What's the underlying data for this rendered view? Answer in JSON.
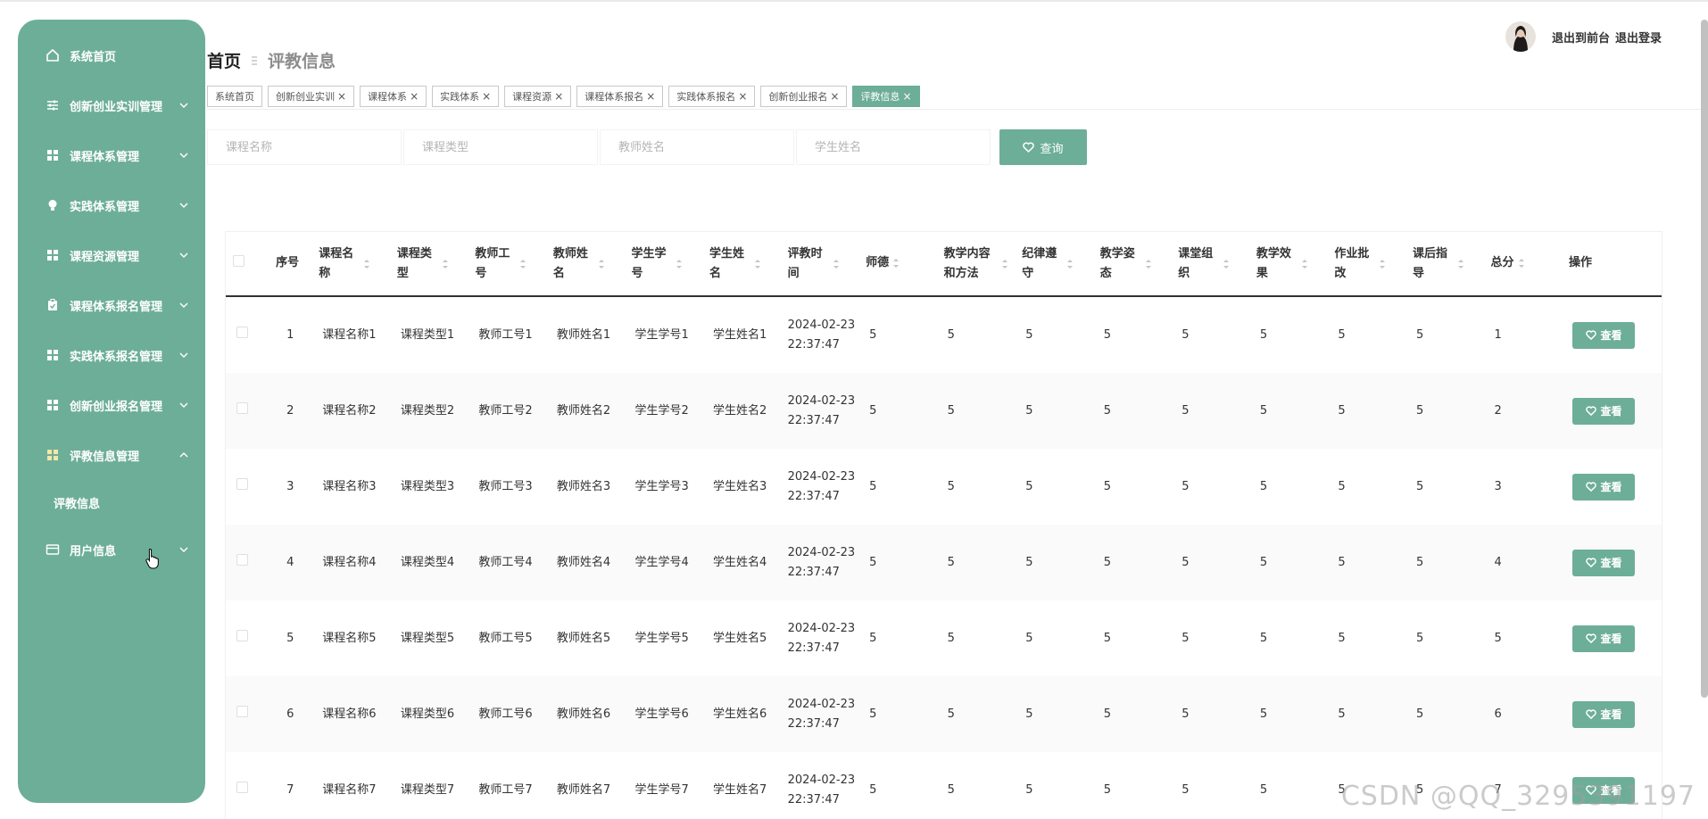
{
  "sidebar": {
    "items": [
      {
        "label": "系统首页",
        "icon": "home-icon",
        "chevron": false
      },
      {
        "label": "创新创业实训管理",
        "icon": "sliders-icon",
        "chevron": true
      },
      {
        "label": "课程体系管理",
        "icon": "grid-icon",
        "chevron": true
      },
      {
        "label": "实践体系管理",
        "icon": "bulb-icon",
        "chevron": true
      },
      {
        "label": "课程资源管理",
        "icon": "grid-icon",
        "chevron": true
      },
      {
        "label": "课程体系报名管理",
        "icon": "clipboard-icon",
        "chevron": true
      },
      {
        "label": "实践体系报名管理",
        "icon": "grid-icon",
        "chevron": true
      },
      {
        "label": "创新创业报名管理",
        "icon": "grid-icon",
        "chevron": true
      },
      {
        "label": "评教信息管理",
        "icon": "grid-icon",
        "chevron": true,
        "expanded": true
      },
      {
        "label": "用户信息",
        "icon": "card-icon",
        "chevron": true
      }
    ],
    "submenu": {
      "label": "评教信息"
    }
  },
  "breadcrumb": {
    "home": "首页",
    "current": "评教信息"
  },
  "header": {
    "to_front": "退出到前台",
    "logout": "退出登录"
  },
  "tags": [
    {
      "label": "系统首页",
      "closable": false,
      "active": false
    },
    {
      "label": "创新创业实训",
      "closable": true,
      "active": false
    },
    {
      "label": "课程体系",
      "closable": true,
      "active": false
    },
    {
      "label": "实践体系",
      "closable": true,
      "active": false
    },
    {
      "label": "课程资源",
      "closable": true,
      "active": false
    },
    {
      "label": "课程体系报名",
      "closable": true,
      "active": false
    },
    {
      "label": "实践体系报名",
      "closable": true,
      "active": false
    },
    {
      "label": "创新创业报名",
      "closable": true,
      "active": false
    },
    {
      "label": "评教信息",
      "closable": true,
      "active": true
    }
  ],
  "filters": {
    "course_name": {
      "placeholder": "课程名称"
    },
    "course_type": {
      "placeholder": "课程类型"
    },
    "teacher_name": {
      "placeholder": "教师姓名"
    },
    "student_name": {
      "placeholder": "学生姓名"
    },
    "query_label": "查询"
  },
  "table": {
    "columns": [
      {
        "key": "no",
        "label": "序号",
        "sortable": false
      },
      {
        "key": "course_name",
        "label": "课程名称",
        "sortable": true
      },
      {
        "key": "course_type",
        "label": "课程类型",
        "sortable": true
      },
      {
        "key": "teacher_id",
        "label": "教师工号",
        "sortable": true
      },
      {
        "key": "teacher_name",
        "label": "教师姓名",
        "sortable": true
      },
      {
        "key": "student_id",
        "label": "学生学号",
        "sortable": true
      },
      {
        "key": "student_name",
        "label": "学生姓名",
        "sortable": true
      },
      {
        "key": "eval_time",
        "label": "评教时间",
        "sortable": true
      },
      {
        "key": "ethics",
        "label": "师德",
        "sortable": true
      },
      {
        "key": "content",
        "label": "教学内容和方法",
        "sortable": true
      },
      {
        "key": "discipline",
        "label": "纪律遵守",
        "sortable": true
      },
      {
        "key": "posture",
        "label": "教学姿态",
        "sortable": true
      },
      {
        "key": "organization",
        "label": "课堂组织",
        "sortable": true
      },
      {
        "key": "effect",
        "label": "教学效果",
        "sortable": true
      },
      {
        "key": "homework",
        "label": "作业批改",
        "sortable": true
      },
      {
        "key": "guidance",
        "label": "课后指导",
        "sortable": true
      },
      {
        "key": "total",
        "label": "总分",
        "sortable": true
      },
      {
        "key": "action",
        "label": "操作",
        "sortable": false
      }
    ],
    "view_label": "查看",
    "rows": [
      {
        "no": "1",
        "course_name": "课程名称1",
        "course_type": "课程类型1",
        "teacher_id": "教师工号1",
        "teacher_name": "教师姓名1",
        "student_id": "学生学号1",
        "student_name": "学生姓名1",
        "eval_time": "2024-02-23 22:37:47",
        "ethics": "5",
        "content": "5",
        "discipline": "5",
        "posture": "5",
        "organization": "5",
        "effect": "5",
        "homework": "5",
        "guidance": "5",
        "total": "1"
      },
      {
        "no": "2",
        "course_name": "课程名称2",
        "course_type": "课程类型2",
        "teacher_id": "教师工号2",
        "teacher_name": "教师姓名2",
        "student_id": "学生学号2",
        "student_name": "学生姓名2",
        "eval_time": "2024-02-23 22:37:47",
        "ethics": "5",
        "content": "5",
        "discipline": "5",
        "posture": "5",
        "organization": "5",
        "effect": "5",
        "homework": "5",
        "guidance": "5",
        "total": "2"
      },
      {
        "no": "3",
        "course_name": "课程名称3",
        "course_type": "课程类型3",
        "teacher_id": "教师工号3",
        "teacher_name": "教师姓名3",
        "student_id": "学生学号3",
        "student_name": "学生姓名3",
        "eval_time": "2024-02-23 22:37:47",
        "ethics": "5",
        "content": "5",
        "discipline": "5",
        "posture": "5",
        "organization": "5",
        "effect": "5",
        "homework": "5",
        "guidance": "5",
        "total": "3"
      },
      {
        "no": "4",
        "course_name": "课程名称4",
        "course_type": "课程类型4",
        "teacher_id": "教师工号4",
        "teacher_name": "教师姓名4",
        "student_id": "学生学号4",
        "student_name": "学生姓名4",
        "eval_time": "2024-02-23 22:37:47",
        "ethics": "5",
        "content": "5",
        "discipline": "5",
        "posture": "5",
        "organization": "5",
        "effect": "5",
        "homework": "5",
        "guidance": "5",
        "total": "4"
      },
      {
        "no": "5",
        "course_name": "课程名称5",
        "course_type": "课程类型5",
        "teacher_id": "教师工号5",
        "teacher_name": "教师姓名5",
        "student_id": "学生学号5",
        "student_name": "学生姓名5",
        "eval_time": "2024-02-23 22:37:47",
        "ethics": "5",
        "content": "5",
        "discipline": "5",
        "posture": "5",
        "organization": "5",
        "effect": "5",
        "homework": "5",
        "guidance": "5",
        "total": "5"
      },
      {
        "no": "6",
        "course_name": "课程名称6",
        "course_type": "课程类型6",
        "teacher_id": "教师工号6",
        "teacher_name": "教师姓名6",
        "student_id": "学生学号6",
        "student_name": "学生姓名6",
        "eval_time": "2024-02-23 22:37:47",
        "ethics": "5",
        "content": "5",
        "discipline": "5",
        "posture": "5",
        "organization": "5",
        "effect": "5",
        "homework": "5",
        "guidance": "5",
        "total": "6"
      },
      {
        "no": "7",
        "course_name": "课程名称7",
        "course_type": "课程类型7",
        "teacher_id": "教师工号7",
        "teacher_name": "教师姓名7",
        "student_id": "学生学号7",
        "student_name": "学生姓名7",
        "eval_time": "2024-02-23 22:37:47",
        "ethics": "5",
        "content": "5",
        "discipline": "5",
        "posture": "5",
        "organization": "5",
        "effect": "5",
        "homework": "5",
        "guidance": "5",
        "total": "7"
      }
    ]
  },
  "watermark": "CSDN @QQ_3295391197",
  "colors": {
    "accent": "#6dae98",
    "header_rule": "#303133"
  }
}
